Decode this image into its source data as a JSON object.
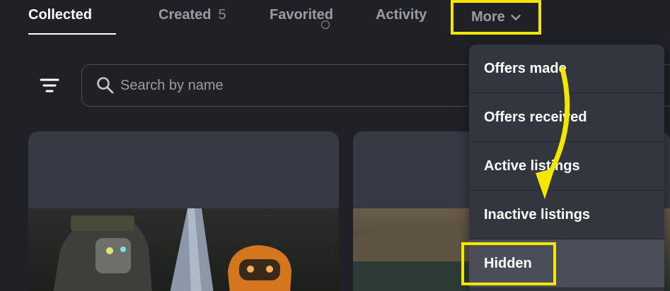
{
  "tabs": {
    "collected": "Collected",
    "created": "Created",
    "created_count": "5",
    "favorited": "Favorited",
    "activity": "Activity",
    "more": "More"
  },
  "search": {
    "placeholder": "Search by name"
  },
  "dropdown": {
    "items": [
      "Offers made",
      "Offers received",
      "Active listings",
      "Inactive listings",
      "Hidden"
    ]
  },
  "colors": {
    "background": "#202127",
    "highlight": "#f3e600",
    "dropdown_bg": "#33353f",
    "card_bg": "#373944"
  },
  "icons": {
    "filter": "filter-icon",
    "search": "search-icon",
    "more_chevron": "chevron-down-icon",
    "annotation": "curved-arrow-icon"
  }
}
